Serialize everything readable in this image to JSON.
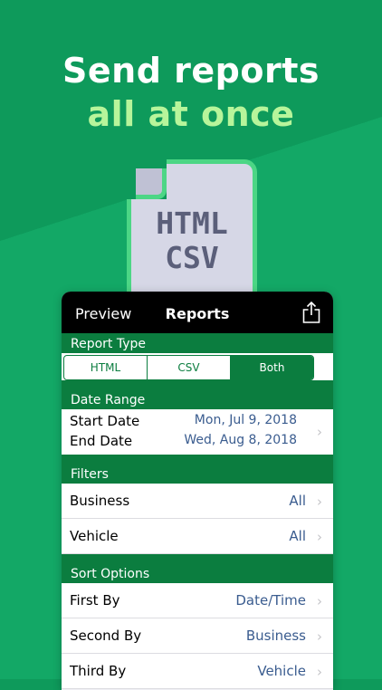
{
  "promo": {
    "headline_line1": "Send reports",
    "headline_line2": "all at once",
    "doc_label_line1": "HTML",
    "doc_label_line2": "CSV"
  },
  "navbar": {
    "left_label": "Preview",
    "title": "Reports",
    "share_icon": "share-icon"
  },
  "report_type": {
    "header": "Report Type",
    "options": [
      "HTML",
      "CSV",
      "Both"
    ],
    "selected": "Both"
  },
  "date_range": {
    "header": "Date Range",
    "start_label": "Start Date",
    "start_value": "Mon, Jul 9, 2018",
    "end_label": "End Date",
    "end_value": "Wed, Aug 8, 2018"
  },
  "filters": {
    "header": "Filters",
    "rows": [
      {
        "label": "Business",
        "value": "All"
      },
      {
        "label": "Vehicle",
        "value": "All"
      }
    ]
  },
  "sort_options": {
    "header": "Sort Options",
    "rows": [
      {
        "label": "First By",
        "value": "Date/Time"
      },
      {
        "label": "Second By",
        "value": "Business"
      },
      {
        "label": "Third By",
        "value": "Vehicle"
      }
    ]
  },
  "colors": {
    "background": "#0e9a5b",
    "section_header": "#0b7d3f",
    "headline_accent": "#b7f59b",
    "value_text": "#3a5c8f"
  }
}
